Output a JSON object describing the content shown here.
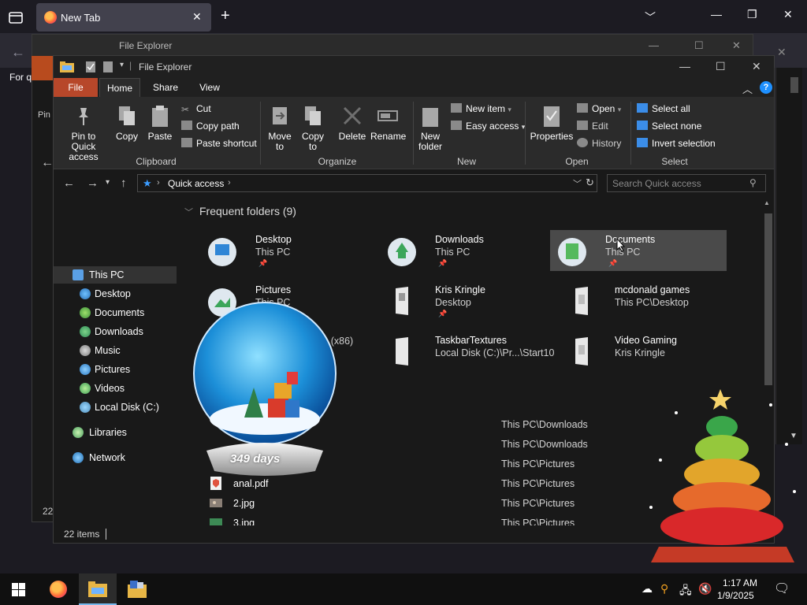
{
  "browser": {
    "tab_title": "New Tab",
    "shortcut_fragment": "For q"
  },
  "bg_window": {
    "title": "File Explorer",
    "left_text": "Pin",
    "left_count": "22"
  },
  "explorer": {
    "title": "File Explorer",
    "tabs": {
      "file": "File",
      "home": "Home",
      "share": "Share",
      "view": "View"
    },
    "ribbon": {
      "pin_label_1": "Pin to Quick",
      "pin_label_2": "access",
      "copy": "Copy",
      "paste": "Paste",
      "cut": "Cut",
      "copy_path": "Copy path",
      "paste_shortcut": "Paste shortcut",
      "clipboard_group": "Clipboard",
      "move_to_1": "Move",
      "move_to_2": "to",
      "copy_to_1": "Copy",
      "copy_to_2": "to",
      "delete": "Delete",
      "rename": "Rename",
      "organize_group": "Organize",
      "new_folder_1": "New",
      "new_folder_2": "folder",
      "new_item": "New item",
      "easy_access": "Easy access",
      "new_group": "New",
      "properties": "Properties",
      "open": "Open",
      "edit": "Edit",
      "history": "History",
      "open_group": "Open",
      "select_all": "Select all",
      "select_none": "Select none",
      "invert_selection": "Invert selection",
      "select_group": "Select"
    },
    "address": {
      "location": "Quick access"
    },
    "search": {
      "placeholder": "Search Quick access"
    },
    "nav": [
      {
        "label": "This PC"
      },
      {
        "label": "Desktop"
      },
      {
        "label": "Documents"
      },
      {
        "label": "Downloads"
      },
      {
        "label": "Music"
      },
      {
        "label": "Pictures"
      },
      {
        "label": "Videos"
      },
      {
        "label": "Local Disk (C:)"
      },
      {
        "label": "Libraries"
      },
      {
        "label": "Network"
      }
    ],
    "frequent_header": "Frequent folders (9)",
    "frequent": [
      {
        "name": "Desktop",
        "sub": "This PC",
        "pinned": true
      },
      {
        "name": "Downloads",
        "sub": "This PC",
        "pinned": true
      },
      {
        "name": "Documents",
        "sub": "This PC",
        "pinned": true
      },
      {
        "name": "Pictures",
        "sub": "This PC",
        "pinned": false
      },
      {
        "name": "Kris Kringle",
        "sub": "Desktop",
        "pinned": true
      },
      {
        "name": "mcdonald games",
        "sub": "This PC\\Desktop",
        "pinned": false
      },
      {
        "name": "",
        "sub": "s (x86)",
        "pinned": false
      },
      {
        "name": "TaskbarTextures",
        "sub": "Local Disk (C:)\\Pr...\\Start10",
        "pinned": false
      },
      {
        "name": "Video Gaming",
        "sub": "Kris Kringle",
        "pinned": false
      }
    ],
    "recent": [
      {
        "name": "",
        "path": "This PC\\Downloads"
      },
      {
        "name": "",
        "path": "This PC\\Downloads"
      },
      {
        "name": "",
        "path": "This PC\\Pictures"
      },
      {
        "name": "anal.pdf",
        "path": "This PC\\Pictures"
      },
      {
        "name": "2.jpg",
        "path": "This PC\\Pictures"
      },
      {
        "name": "3.jpg",
        "path": "This PC\\Pictures"
      }
    ],
    "status": "22 items"
  },
  "gadget": {
    "days": "349 days"
  },
  "taskbar": {
    "time": "1:17 AM",
    "date": "1/9/2025"
  }
}
